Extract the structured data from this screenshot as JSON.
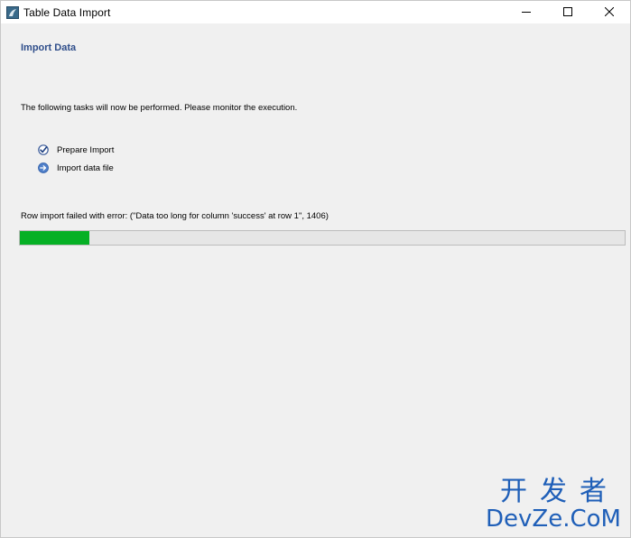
{
  "window": {
    "title": "Table Data Import",
    "controls": {
      "minimize_icon": "minimize-icon",
      "maximize_icon": "maximize-icon",
      "close_icon": "close-icon"
    }
  },
  "page": {
    "heading": "Import Data",
    "intro": "The following tasks will now be performed. Please monitor the execution.",
    "tasks": [
      {
        "label": "Prepare Import",
        "status": "done",
        "icon": "checkmark-icon"
      },
      {
        "label": "Import data file",
        "status": "in-progress",
        "icon": "arrow-right-icon"
      }
    ],
    "error_message": "Row import failed with error: (\"Data too long for column 'success' at row 1\", 1406)",
    "progress": {
      "fraction": 0.115,
      "color": "#06b025"
    }
  },
  "watermark": {
    "line1": "开发者",
    "line2": "DevZe.CoM",
    "color": "#1f5fb8"
  }
}
